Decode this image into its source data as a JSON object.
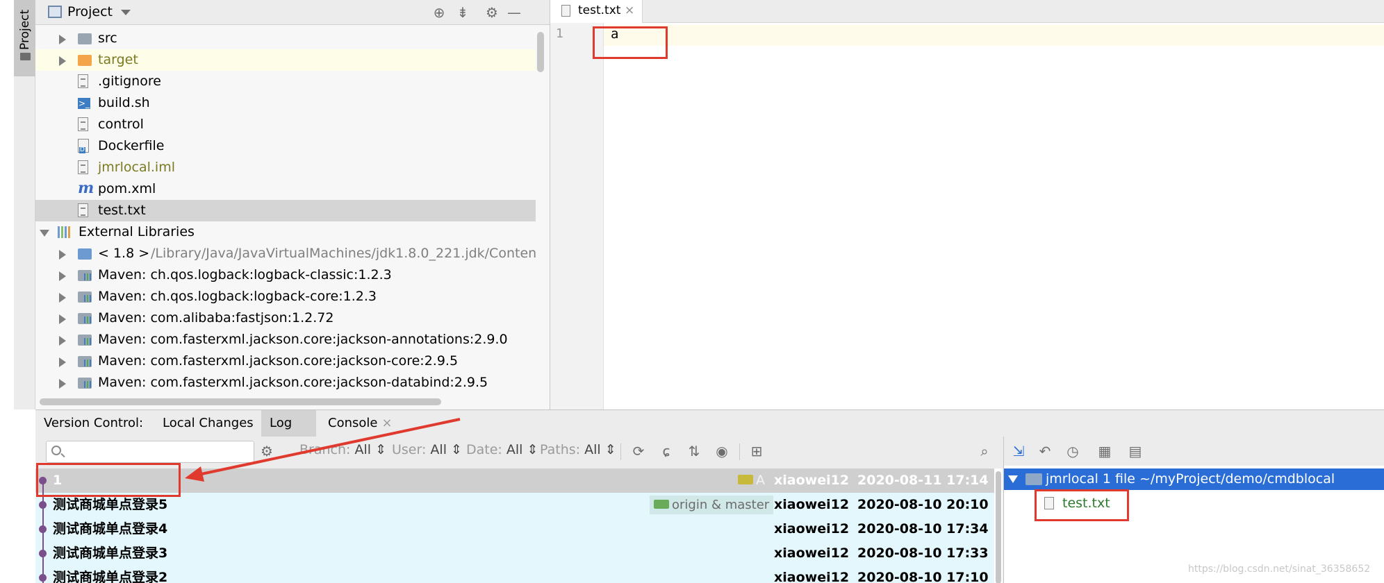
{
  "sidebar": {
    "project_tab": "Project"
  },
  "project": {
    "title": "Project",
    "tree": [
      {
        "label": "src",
        "icon": "folder-icon",
        "level": 1,
        "arrow": "right"
      },
      {
        "label": "target",
        "icon": "folder-icon",
        "level": 1,
        "arrow": "right",
        "color": "#7b7a21",
        "highlight": "#fefde8"
      },
      {
        "label": ".gitignore",
        "icon": "text-file-icon",
        "level": 1
      },
      {
        "label": "build.sh",
        "icon": "shell-script-icon",
        "level": 1
      },
      {
        "label": "control",
        "icon": "text-file-icon",
        "level": 1
      },
      {
        "label": "Dockerfile",
        "icon": "docker-file-icon",
        "level": 1
      },
      {
        "label": "jmrlocal.iml",
        "icon": "module-file-icon",
        "level": 1,
        "color": "#7b7a21"
      },
      {
        "label": "pom.xml",
        "icon": "maven-icon",
        "level": 1
      },
      {
        "label": "test.txt",
        "icon": "text-file-icon",
        "level": 1,
        "selected": true
      },
      {
        "label": "External Libraries",
        "icon": "libraries-icon",
        "level": 0,
        "arrow": "down"
      },
      {
        "label": "< 1.8 >",
        "suffix": "/Library/Java/JavaVirtualMachines/jdk1.8.0_221.jdk/Conten",
        "icon": "jdk-icon",
        "level": 1,
        "arrow": "right"
      },
      {
        "label": "Maven: ch.qos.logback:logback-classic:1.2.3",
        "icon": "maven-library-icon",
        "level": 1,
        "arrow": "right"
      },
      {
        "label": "Maven: ch.qos.logback:logback-core:1.2.3",
        "icon": "maven-library-icon",
        "level": 1,
        "arrow": "right"
      },
      {
        "label": "Maven: com.alibaba:fastjson:1.2.72",
        "icon": "maven-library-icon",
        "level": 1,
        "arrow": "right"
      },
      {
        "label": "Maven: com.fasterxml.jackson.core:jackson-annotations:2.9.0",
        "icon": "maven-library-icon",
        "level": 1,
        "arrow": "right"
      },
      {
        "label": "Maven: com.fasterxml.jackson.core:jackson-core:2.9.5",
        "icon": "maven-library-icon",
        "level": 1,
        "arrow": "right"
      },
      {
        "label": "Maven: com.fasterxml.jackson.core:jackson-databind:2.9.5",
        "icon": "maven-library-icon",
        "level": 1,
        "arrow": "right"
      }
    ]
  },
  "editor": {
    "tab_label": "test.txt",
    "tab_close": "×",
    "line_number": "1",
    "code": "a"
  },
  "vcs": {
    "title": "Version Control:",
    "tabs": [
      "Local Changes",
      "Log",
      "Console"
    ],
    "console_close": "×",
    "search_placeholder": "",
    "filters": {
      "branch_label": "Branch:",
      "branch_value": "All",
      "user_label": "User:",
      "user_value": "All",
      "date_label": "Date:",
      "date_value": "All",
      "paths_label": "Paths:",
      "paths_value": "All"
    },
    "commits": [
      {
        "message": "1",
        "tag": "A",
        "author": "xiaowei12",
        "date": "2020-08-11 17:14",
        "selected": true
      },
      {
        "message": "测试商城单点登录5",
        "refs": "origin & master",
        "author": "xiaowei12",
        "date": "2020-08-10 20:10"
      },
      {
        "message": "测试商城单点登录4",
        "author": "xiaowei12",
        "date": "2020-08-10 17:34"
      },
      {
        "message": "测试商城单点登录3",
        "author": "xiaowei12",
        "date": "2020-08-10 17:33"
      },
      {
        "message": "测试商城单点登录2",
        "author": "xiaowei12",
        "date": "2020-08-10 17:10"
      }
    ],
    "changes": {
      "root_label": "jmrlocal  1 file  ~/myProject/demo/cmdblocal",
      "file": "test.txt"
    }
  },
  "watermark": "https://blog.csdn.net/sinat_36358652",
  "colors": {
    "selection_blue": "#2a6dd6",
    "annotation_red": "#e03a2e",
    "commit_graph": "#7a4f8c"
  }
}
